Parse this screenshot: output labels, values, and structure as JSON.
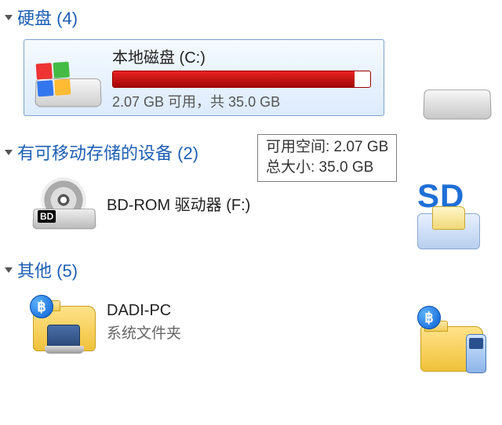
{
  "sections": {
    "hdd": {
      "label": "硬盘",
      "count": "(4)"
    },
    "removable": {
      "label": "有可移动存储的设备",
      "count": "(2)"
    },
    "other": {
      "label": "其他",
      "count": "(5)"
    }
  },
  "drive_c": {
    "name": "本地磁盘 (C:)",
    "usage_text": "2.07 GB 可用，共 35.0 GB",
    "fill_percent": 94
  },
  "tooltip": {
    "line1": "可用空间: 2.07 GB",
    "line2": "总大小: 35.0 GB"
  },
  "bdrom": {
    "label": "BD-ROM 驱动器 (F:)",
    "badge": "BD"
  },
  "sd": {
    "label": "SD"
  },
  "dadi": {
    "name": "DADI-PC",
    "subtype": "系统文件夹"
  },
  "bt_glyph": "฿"
}
